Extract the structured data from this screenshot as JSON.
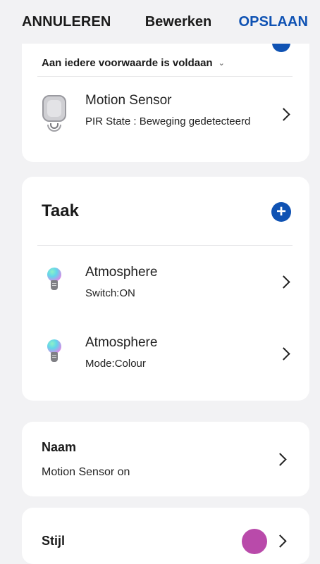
{
  "header": {
    "cancel_label": "ANNULEREN",
    "title": "Bewerken",
    "save_label": "OPSLAAN"
  },
  "condition": {
    "mode_label": "Aan iedere voorwaarde is voldaan",
    "device": {
      "name": "Motion Sensor",
      "state": "PIR State : Beweging gedetecteerd"
    }
  },
  "tasks": {
    "title": "Taak",
    "items": [
      {
        "name": "Atmosphere",
        "detail": "Switch:ON"
      },
      {
        "name": "Atmosphere",
        "detail": "Mode:Colour"
      }
    ]
  },
  "name_section": {
    "label": "Naam",
    "value": "Motion Sensor on"
  },
  "style_section": {
    "label": "Stijl",
    "color": "#b94aaa"
  },
  "colors": {
    "accent": "#0f52b3",
    "background": "#f2f2f4",
    "card": "#ffffff"
  },
  "icons": {
    "sensor": "motion-sensor-icon",
    "bulb": "smart-bulb-icon",
    "add": "plus-icon",
    "chevron": "chevron-right-icon",
    "dropdown": "chevron-down-icon"
  }
}
